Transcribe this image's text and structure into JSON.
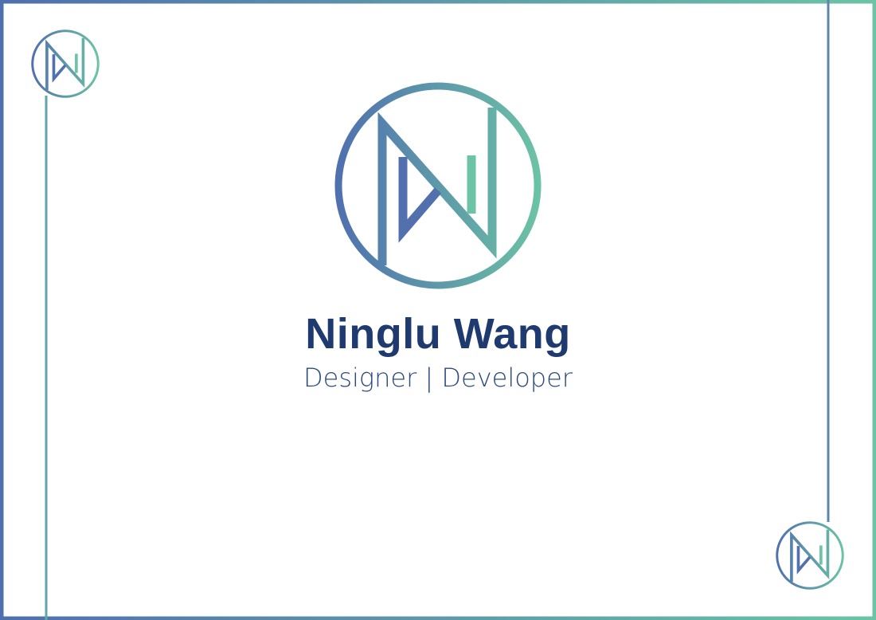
{
  "card": {
    "name": "Ninglu Wang",
    "role": "Designer | Developer",
    "logo_monogram": "NW",
    "colors": {
      "gradient_start": "#4f6fae",
      "gradient_end": "#6cc3a5",
      "text": "#1f3a6e"
    }
  }
}
